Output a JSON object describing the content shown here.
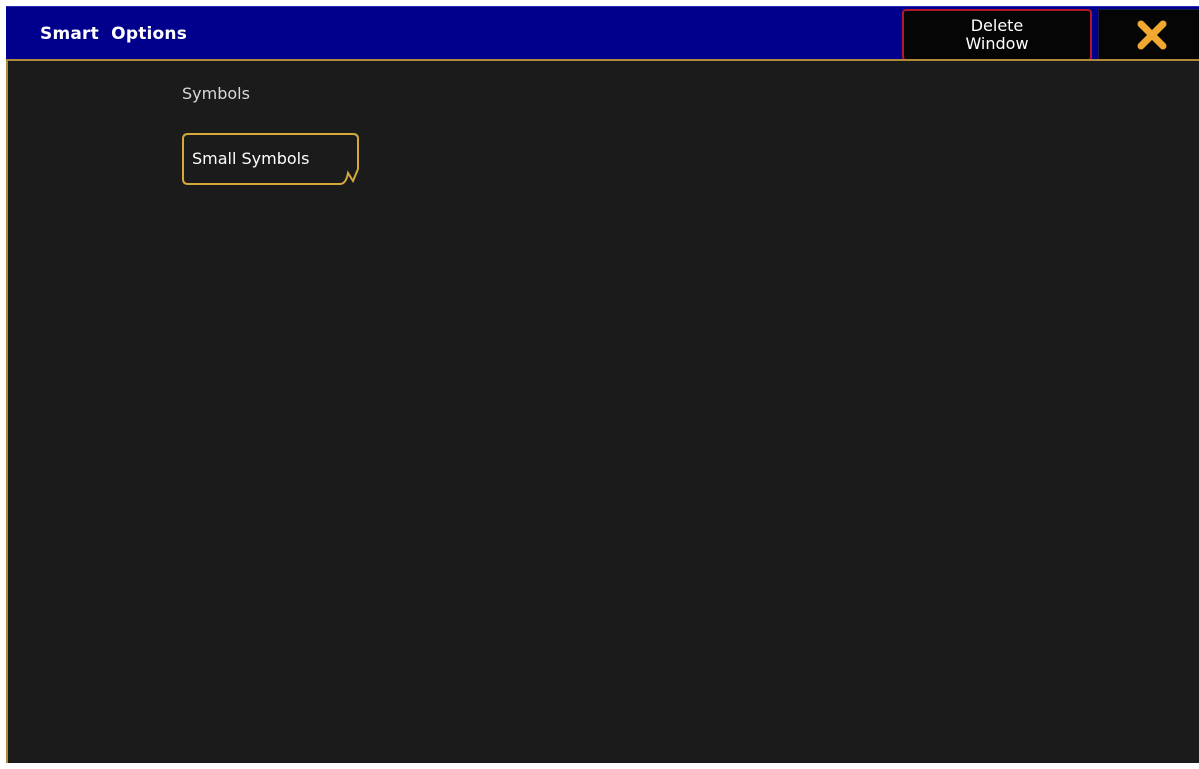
{
  "window": {
    "title": "Smart  Options",
    "delete_button_label": "Delete\nWindow",
    "close_icon": "close-x-icon"
  },
  "colors": {
    "titlebar": "#00008c",
    "content_bg": "#1b1b1b",
    "accent_border": "#d4a93a",
    "delete_border": "#b2182b",
    "close_icon": "#f0a830"
  },
  "options": {
    "section_label": "Symbols",
    "buttons": [
      {
        "label": "Small Symbols",
        "has_dropdown": true
      }
    ]
  }
}
